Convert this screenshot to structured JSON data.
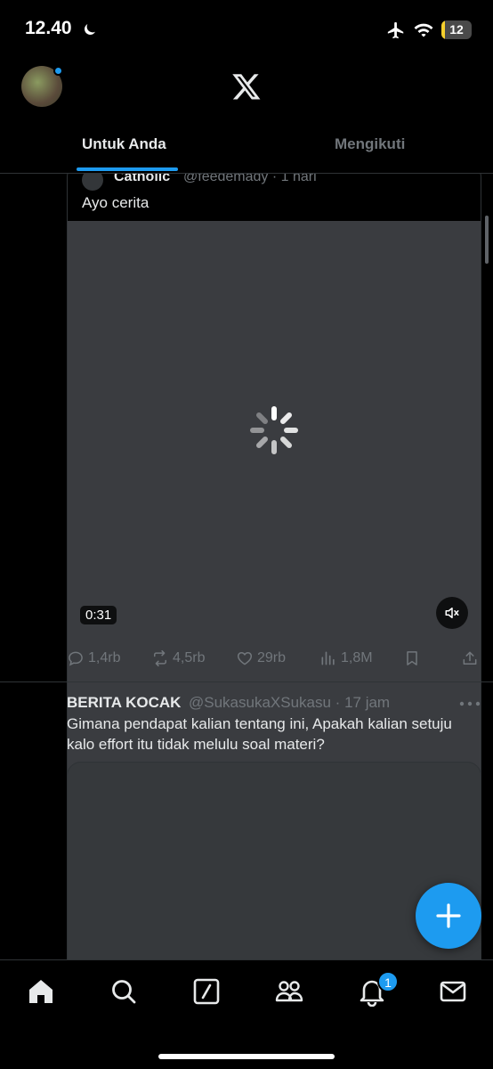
{
  "status_bar": {
    "time": "12.40",
    "battery": "12",
    "battery_level": 0.12
  },
  "header": {
    "tabs": [
      {
        "label": "Untuk Anda",
        "active": true
      },
      {
        "label": "Mengikuti",
        "active": false
      }
    ]
  },
  "post1": {
    "quoted": {
      "author": "Catholic",
      "handle_time": "@feedemady · 1 hari",
      "text": "Ayo cerita"
    },
    "video": {
      "duration": "0:31"
    },
    "actions": {
      "replies": "1,4rb",
      "reposts": "4,5rb",
      "likes": "29rb",
      "views": "1,8M"
    }
  },
  "post2": {
    "author": "BERITA KOCAK",
    "handle_time": "@SukasukaXSukasu · 17 jam",
    "text": "Gimana pendapat kalian tentang ini, Apakah kalian setuju kalo effort itu tidak melulu soal materi?"
  },
  "bottom_nav": {
    "items": [
      "home-icon",
      "search-icon",
      "grok-icon",
      "communities-icon",
      "notifications-icon",
      "messages-icon"
    ],
    "notification_count": "1"
  },
  "colors": {
    "accent": "#1d9bf0",
    "background": "#000000",
    "secondary_text": "#71767b"
  }
}
